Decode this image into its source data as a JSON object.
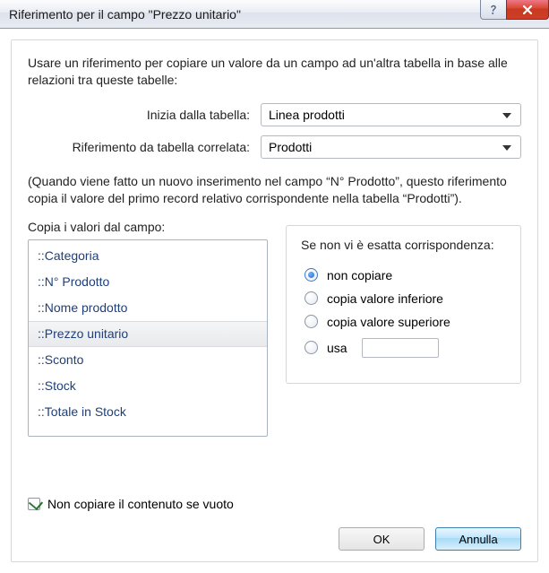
{
  "window": {
    "title": "Riferimento per il campo \"Prezzo unitario\""
  },
  "intro": "Usare un riferimento per copiare un valore da un campo ad un'altra tabella in base alle relazioni tra queste tabelle:",
  "start_table": {
    "label": "Inizia dalla tabella:",
    "value": "Linea prodotti"
  },
  "related_table": {
    "label": "Riferimento da tabella correlata:",
    "value": "Prodotti"
  },
  "note": "(Quando viene fatto un nuovo inserimento nel campo “N° Prodotto”, questo riferimento copia il valore del primo record relativo corrispondente nella tabella “Prodotti”).",
  "fields_label": "Copia i valori dal campo:",
  "fields": [
    {
      "label": "::Categoria",
      "selected": false
    },
    {
      "label": "::N° Prodotto",
      "selected": false
    },
    {
      "label": "::Nome prodotto",
      "selected": false
    },
    {
      "label": "::Prezzo unitario",
      "selected": true
    },
    {
      "label": "::Sconto",
      "selected": false
    },
    {
      "label": "::Stock",
      "selected": false
    },
    {
      "label": "::Totale in Stock",
      "selected": false
    }
  ],
  "nomatch": {
    "legend": "Se non vi è esatta corrispondenza:",
    "options": {
      "none": {
        "label": "non copiare",
        "checked": true
      },
      "lower": {
        "label": "copia valore inferiore",
        "checked": false
      },
      "higher": {
        "label": "copia valore superiore",
        "checked": false
      },
      "use": {
        "label": "usa",
        "checked": false,
        "value": ""
      }
    }
  },
  "dont_copy_empty": {
    "label": "Non copiare il contenuto se vuoto",
    "checked": true
  },
  "buttons": {
    "ok": "OK",
    "cancel": "Annulla"
  }
}
